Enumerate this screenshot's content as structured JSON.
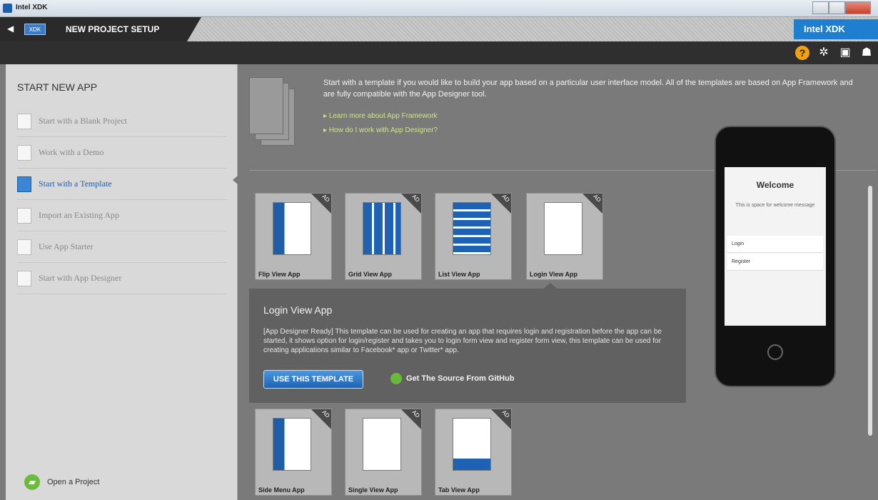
{
  "window": {
    "title": "Intel XDK"
  },
  "header": {
    "title": "NEW PROJECT SETUP",
    "badge": "XDK",
    "brand": "Intel XDK"
  },
  "sidebar": {
    "heading": "START NEW APP",
    "items": [
      {
        "label": "Start with a Blank Project"
      },
      {
        "label": "Work with a Demo"
      },
      {
        "label": "Start with a Template"
      },
      {
        "label": "Import an Existing App"
      },
      {
        "label": "Use App Starter"
      },
      {
        "label": "Start with App Designer"
      }
    ],
    "open_project": "Open a Project"
  },
  "main": {
    "intro": "Start with a template if you would like to build your app based on a particular user interface model. All of the templates are based on App Framework and are fully compatible with the App Designer tool.",
    "links": [
      "Learn more about App Framework",
      "How do I work with App Designer?"
    ],
    "templates": [
      {
        "label": "Flip View App",
        "badge": "AD"
      },
      {
        "label": "Grid View App",
        "badge": "AD"
      },
      {
        "label": "List View App",
        "badge": "AD"
      },
      {
        "label": "Login View App",
        "badge": "AD"
      },
      {
        "label": "Side Menu App",
        "badge": "AD"
      },
      {
        "label": "Single View App",
        "badge": "AD"
      },
      {
        "label": "Tab View App",
        "badge": "AD"
      }
    ],
    "detail": {
      "title": "Login View App",
      "text": "[App Designer Ready] This template can be used for creating an app that requires login and registration before the app can be started, it shows option for login/register and takes you to login form view and register form view, this template can be used for creating applications similar to Facebook* app or Twitter* app.",
      "use_button": "USE THIS TEMPLATE",
      "github": "Get The Source From GitHub"
    },
    "phone": {
      "welcome": "Welcome",
      "message": "This is space for welcome message",
      "rows": [
        "Login",
        "Register"
      ]
    }
  }
}
